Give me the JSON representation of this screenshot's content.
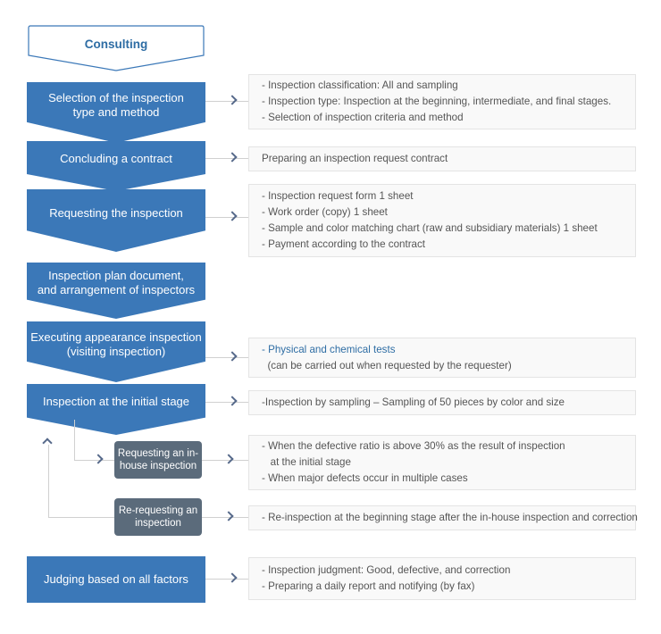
{
  "diagram": {
    "title": "Inspection process flowchart",
    "colors": {
      "process_blue": "#3B78B8",
      "subprocess_gray": "#5B6B7B",
      "note_background": "#F9F9F9",
      "note_border": "#E4E4E4",
      "connector": "#D0D0D0",
      "accent_text": "#2E6DA4"
    }
  },
  "start": {
    "label": "Consulting"
  },
  "steps": [
    {
      "id": "selection",
      "line1": "Selection of the inspection",
      "line2": "type and method"
    },
    {
      "id": "contract",
      "line1": "Concluding a contract",
      "line2": ""
    },
    {
      "id": "requesting",
      "line1": "Requesting the inspection",
      "line2": ""
    },
    {
      "id": "plan",
      "line1": "Inspection plan document,",
      "line2": "and arrangement of inspectors"
    },
    {
      "id": "appearance",
      "line1": "Executing appearance inspection",
      "line2": "(visiting inspection)"
    },
    {
      "id": "initial",
      "line1": "Inspection at the initial stage",
      "line2": ""
    },
    {
      "id": "judging",
      "line1": "Judging based on all factors",
      "line2": ""
    }
  ],
  "subprocesses": [
    {
      "id": "in-house",
      "line1": "Requesting an",
      "line2": "in-house inspection"
    },
    {
      "id": "re-requesting",
      "line1": "Re-requesting",
      "line2": "an inspection"
    }
  ],
  "notes": [
    {
      "id": "note-selection",
      "lines": [
        {
          "text": "- Inspection classification: All and sampling",
          "accent": false
        },
        {
          "text": "- Inspection type: Inspection at the beginning, intermediate, and final stages.",
          "accent": false
        },
        {
          "text": "- Selection of inspection criteria and method",
          "accent": false
        }
      ]
    },
    {
      "id": "note-contract",
      "lines": [
        {
          "text": "Preparing an inspection request contract",
          "accent": false
        }
      ]
    },
    {
      "id": "note-requesting",
      "lines": [
        {
          "text": "- Inspection request form 1 sheet",
          "accent": false
        },
        {
          "text": "- Work order (copy) 1 sheet",
          "accent": false
        },
        {
          "text": "- Sample and color matching chart (raw and subsidiary materials) 1 sheet",
          "accent": false
        },
        {
          "text": "- Payment according to the contract",
          "accent": false
        }
      ]
    },
    {
      "id": "note-appearance",
      "lines": [
        {
          "text": "- Physical and chemical tests",
          "accent": true
        },
        {
          "text": "  (can be carried out when requested by the requester)",
          "accent": false
        }
      ]
    },
    {
      "id": "note-initial",
      "lines": [
        {
          "text": "-Inspection by sampling – Sampling of 50 pieces by color and size",
          "accent": false
        }
      ]
    },
    {
      "id": "note-in-house",
      "lines": [
        {
          "text": "- When the defective ratio is above 30% as the result of inspection",
          "accent": false
        },
        {
          "text": "   at the initial stage",
          "accent": false
        },
        {
          "text": "- When major defects occur in multiple cases",
          "accent": false
        }
      ]
    },
    {
      "id": "note-re-requesting",
      "lines": [
        {
          "text": "- Re-inspection at the beginning stage after the in-house inspection and correction",
          "accent": false
        }
      ]
    },
    {
      "id": "note-judging",
      "lines": [
        {
          "text": "- Inspection judgment: Good, defective, and correction",
          "accent": false
        },
        {
          "text": "- Preparing a daily report and notifying (by fax)",
          "accent": false
        }
      ]
    }
  ]
}
